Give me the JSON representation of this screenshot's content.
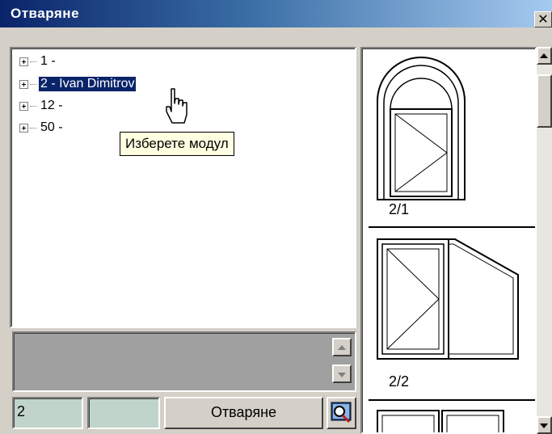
{
  "window": {
    "title": "Отваряне",
    "close_glyph": "✕"
  },
  "tree": {
    "items": [
      {
        "label": "1 -",
        "selected": false
      },
      {
        "label": "2 - Ivan Dimitrov",
        "selected": true
      },
      {
        "label": "12 -",
        "selected": false
      },
      {
        "label": "50 -",
        "selected": false
      }
    ]
  },
  "tooltip": {
    "text": "Изберете модул"
  },
  "bottom": {
    "field1_value": "2",
    "field2_value": "",
    "open_button_label": "Отваряне",
    "search_icon": "search-icon"
  },
  "preview": {
    "items": [
      {
        "label": "2/1",
        "shape": "arched-window"
      },
      {
        "label": "2/2",
        "shape": "window-with-panel"
      },
      {
        "label": "",
        "shape": "double-window"
      }
    ]
  }
}
